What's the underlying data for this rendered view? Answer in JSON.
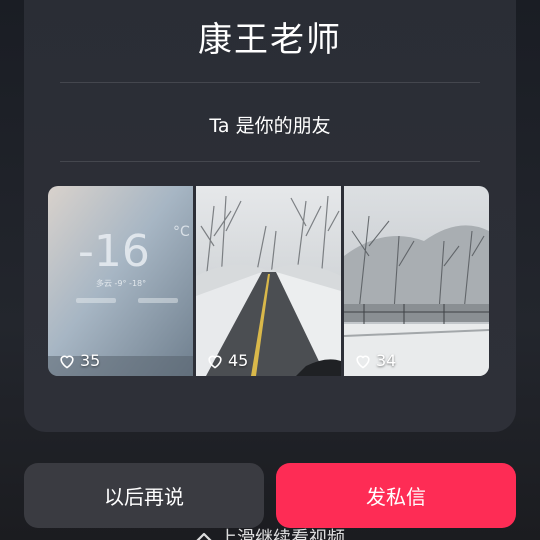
{
  "profile": {
    "name": "康王老师",
    "relation": "Ta 是你的朋友"
  },
  "thumbnails": [
    {
      "likes": "35",
      "overlay": {
        "temp": "-16",
        "weather": "多云 -9° -18°"
      }
    },
    {
      "likes": "45"
    },
    {
      "likes": "34"
    }
  ],
  "actions": {
    "later_label": "以后再说",
    "message_label": "发私信"
  },
  "footer": {
    "swipe_hint": "上滑继续看视频"
  },
  "colors": {
    "accent": "#fe2c55",
    "secondary_button": "#3a3b41"
  }
}
